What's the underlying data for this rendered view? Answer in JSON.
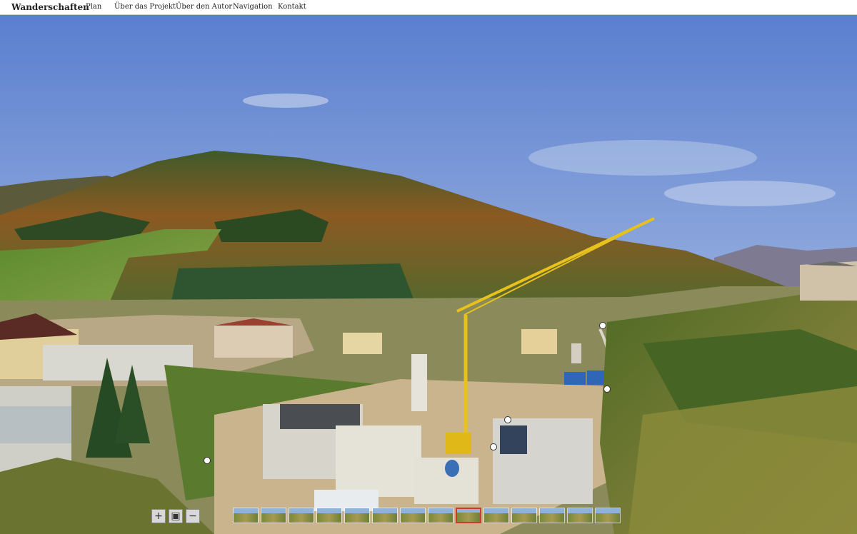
{
  "header": {
    "brand": "Wanderschaften",
    "nav": [
      {
        "label": "Plan"
      },
      {
        "label": "Über das Projekt"
      },
      {
        "label": "Über den Autor"
      },
      {
        "label": "Navigation"
      },
      {
        "label": "Kontakt"
      }
    ]
  },
  "viewer": {
    "image_desc_icon": "panorama-construction-site",
    "hotspot_count": 5,
    "controls": [
      {
        "icon": "zoom-in-icon",
        "glyph": "+"
      },
      {
        "icon": "fit-screen-icon",
        "glyph": "▣"
      },
      {
        "icon": "zoom-out-icon",
        "glyph": "−"
      }
    ],
    "thumbnail_count": 14,
    "active_thumbnail": 9
  },
  "colors": {
    "accent": "#d03a2a",
    "sky_top": "#5b7fcf",
    "crane": "#e8c21c"
  }
}
